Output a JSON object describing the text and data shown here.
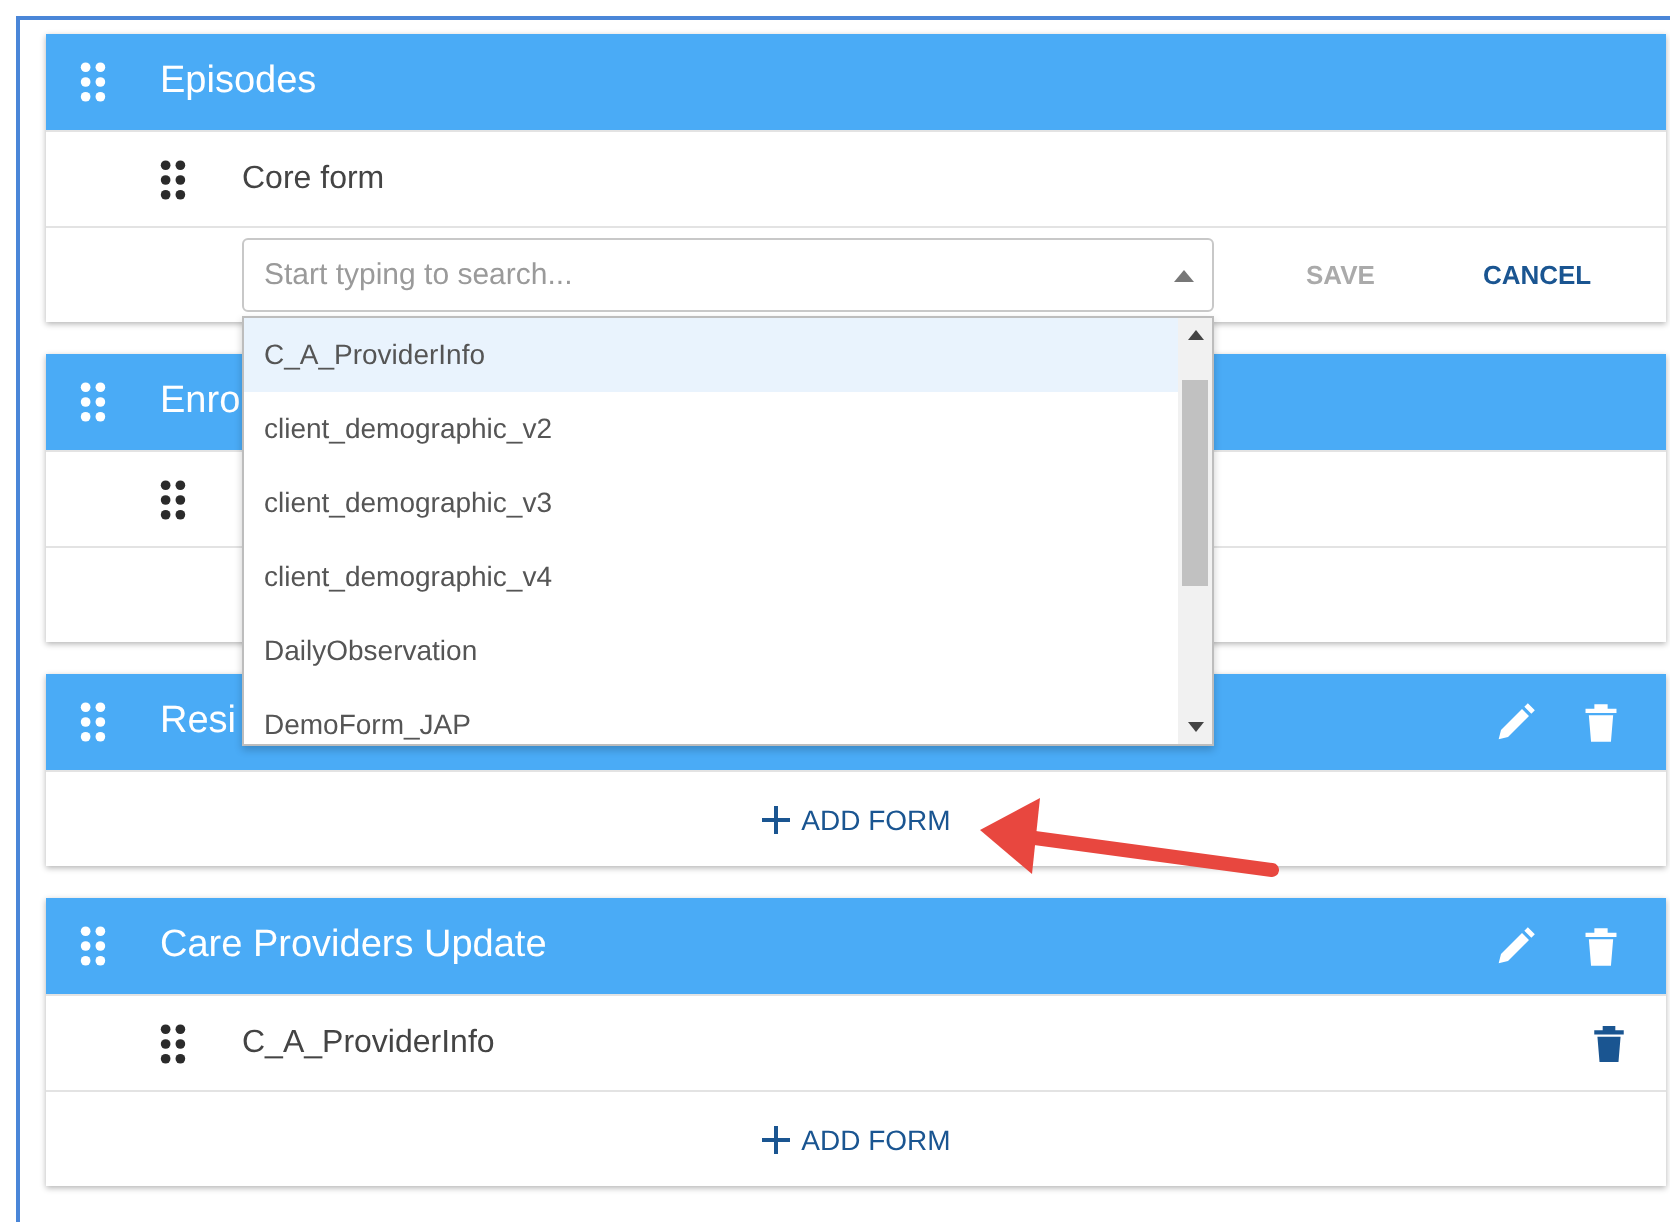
{
  "sections": [
    {
      "title": "Episodes",
      "actions": false,
      "rows": [
        {
          "kind": "item",
          "name": "Core form",
          "deletable": false
        },
        {
          "kind": "picker",
          "placeholder": "Start typing to search...",
          "save": "SAVE",
          "save_disabled": true,
          "cancel": "CANCEL"
        }
      ]
    },
    {
      "title": "Enro",
      "actions": false,
      "rows": [
        {
          "kind": "item",
          "deletable": false
        },
        {
          "kind": "blank"
        }
      ]
    },
    {
      "title": "Resi",
      "actions": true,
      "rows": [
        {
          "kind": "add",
          "label": "ADD FORM"
        }
      ]
    },
    {
      "title": "Care Providers Update",
      "actions": true,
      "rows": [
        {
          "kind": "item",
          "name": "C_A_ProviderInfo",
          "deletable": true
        },
        {
          "kind": "add",
          "label": "ADD FORM"
        }
      ]
    }
  ],
  "dropdown": {
    "options": [
      {
        "label": "C_A_ProviderInfo",
        "selected": true
      },
      {
        "label": "client_demographic_v2",
        "selected": false
      },
      {
        "label": "client_demographic_v3",
        "selected": false
      },
      {
        "label": "client_demographic_v4",
        "selected": false
      },
      {
        "label": "DailyObservation",
        "selected": false
      },
      {
        "label": "DemoForm_JAP",
        "selected": false
      }
    ]
  },
  "callout_arrow": true
}
